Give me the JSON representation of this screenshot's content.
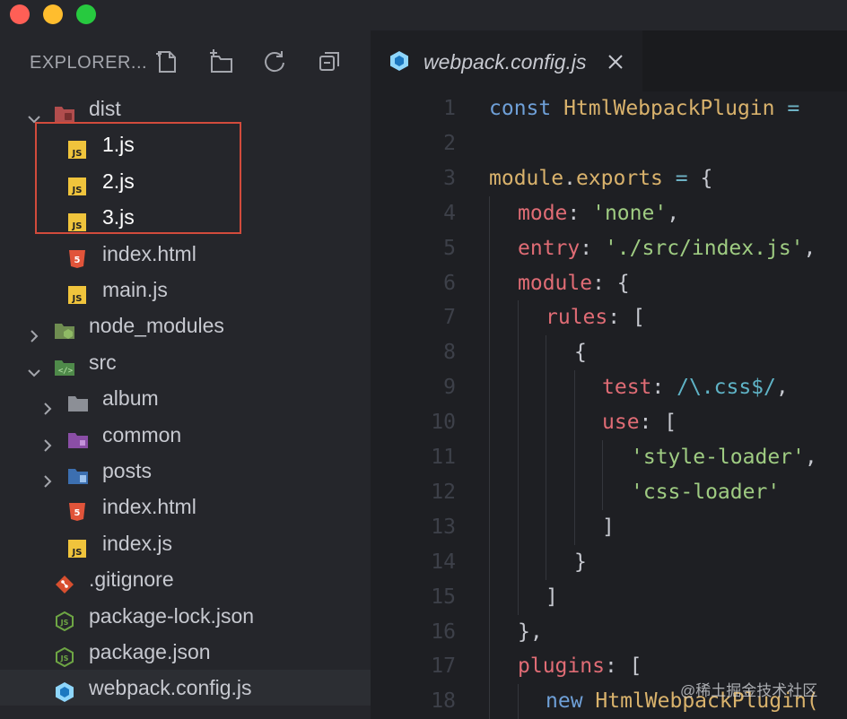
{
  "window": {
    "traffic_lights": [
      {
        "name": "close",
        "color": "#ff5f56"
      },
      {
        "name": "minimize",
        "color": "#ffbd2e"
      },
      {
        "name": "maximize",
        "color": "#27c93f"
      }
    ]
  },
  "explorer": {
    "title": "EXPLORER...",
    "actions": [
      "new-file-icon",
      "new-folder-icon",
      "refresh-icon",
      "collapse-all-icon"
    ],
    "items": [
      {
        "label": "dist",
        "type": "folder",
        "state": "expanded",
        "depth": 0,
        "icon": "folder-dist-icon"
      },
      {
        "label": "1.js",
        "type": "file",
        "depth": 1,
        "icon": "js-file-icon"
      },
      {
        "label": "2.js",
        "type": "file",
        "depth": 1,
        "icon": "js-file-icon"
      },
      {
        "label": "3.js",
        "type": "file",
        "depth": 1,
        "icon": "js-file-icon"
      },
      {
        "label": "index.html",
        "type": "file",
        "depth": 1,
        "icon": "html-file-icon"
      },
      {
        "label": "main.js",
        "type": "file",
        "depth": 1,
        "icon": "js-file-icon"
      },
      {
        "label": "node_modules",
        "type": "folder",
        "state": "collapsed",
        "depth": 0,
        "icon": "folder-node-icon"
      },
      {
        "label": "src",
        "type": "folder",
        "state": "expanded",
        "depth": 0,
        "icon": "folder-src-icon"
      },
      {
        "label": "album",
        "type": "folder",
        "state": "collapsed",
        "depth": 1,
        "icon": "folder-icon"
      },
      {
        "label": "common",
        "type": "folder",
        "state": "collapsed",
        "depth": 1,
        "icon": "folder-common-icon"
      },
      {
        "label": "posts",
        "type": "folder",
        "state": "collapsed",
        "depth": 1,
        "icon": "folder-posts-icon"
      },
      {
        "label": "index.html",
        "type": "file",
        "depth": 1,
        "icon": "html-file-icon"
      },
      {
        "label": "index.js",
        "type": "file",
        "depth": 1,
        "icon": "js-file-icon"
      },
      {
        "label": ".gitignore",
        "type": "file",
        "depth": 0,
        "icon": "git-icon"
      },
      {
        "label": "package-lock.json",
        "type": "file",
        "depth": 0,
        "icon": "nodejs-icon"
      },
      {
        "label": "package.json",
        "type": "file",
        "depth": 0,
        "icon": "nodejs-icon"
      },
      {
        "label": "webpack.config.js",
        "type": "file",
        "depth": 0,
        "icon": "webpack-icon",
        "selected": true
      }
    ]
  },
  "editor": {
    "tab": {
      "label": "webpack.config.js",
      "icon": "webpack-icon"
    },
    "lines": [
      {
        "n": "1",
        "indent": 0,
        "tokens": [
          [
            "kw",
            "const "
          ],
          [
            "cls",
            "HtmlWebpackPlugin "
          ],
          [
            "op",
            "="
          ]
        ]
      },
      {
        "n": "2",
        "indent": 0,
        "tokens": []
      },
      {
        "n": "3",
        "indent": 0,
        "tokens": [
          [
            "cls",
            "module"
          ],
          [
            "punc",
            "."
          ],
          [
            "cls",
            "exports "
          ],
          [
            "op",
            "="
          ],
          [
            "punc",
            " {"
          ]
        ]
      },
      {
        "n": "4",
        "indent": 1,
        "tokens": [
          [
            "prop",
            "mode"
          ],
          [
            "punc",
            ": "
          ],
          [
            "str",
            "'none'"
          ],
          [
            "punc",
            ","
          ]
        ]
      },
      {
        "n": "5",
        "indent": 1,
        "tokens": [
          [
            "prop",
            "entry"
          ],
          [
            "punc",
            ": "
          ],
          [
            "str",
            "'./src/index.js'"
          ],
          [
            "punc",
            ","
          ]
        ]
      },
      {
        "n": "6",
        "indent": 1,
        "tokens": [
          [
            "prop",
            "module"
          ],
          [
            "punc",
            ": {"
          ]
        ]
      },
      {
        "n": "7",
        "indent": 2,
        "tokens": [
          [
            "prop",
            "rules"
          ],
          [
            "punc",
            ": ["
          ]
        ]
      },
      {
        "n": "8",
        "indent": 3,
        "tokens": [
          [
            "punc",
            "{"
          ]
        ]
      },
      {
        "n": "9",
        "indent": 4,
        "tokens": [
          [
            "prop",
            "test"
          ],
          [
            "punc",
            ": "
          ],
          [
            "rx",
            "/\\.css$/"
          ],
          [
            "punc",
            ","
          ]
        ]
      },
      {
        "n": "10",
        "indent": 4,
        "tokens": [
          [
            "prop",
            "use"
          ],
          [
            "punc",
            ": ["
          ]
        ]
      },
      {
        "n": "11",
        "indent": 5,
        "tokens": [
          [
            "str",
            "'style-loader'"
          ],
          [
            "punc",
            ","
          ]
        ]
      },
      {
        "n": "12",
        "indent": 5,
        "tokens": [
          [
            "str",
            "'css-loader'"
          ]
        ]
      },
      {
        "n": "13",
        "indent": 4,
        "tokens": [
          [
            "punc",
            "]"
          ]
        ]
      },
      {
        "n": "14",
        "indent": 3,
        "tokens": [
          [
            "punc",
            "}"
          ]
        ]
      },
      {
        "n": "15",
        "indent": 2,
        "tokens": [
          [
            "punc",
            "]"
          ]
        ]
      },
      {
        "n": "16",
        "indent": 1,
        "tokens": [
          [
            "punc",
            "},"
          ]
        ]
      },
      {
        "n": "17",
        "indent": 1,
        "tokens": [
          [
            "prop",
            "plugins"
          ],
          [
            "punc",
            ": ["
          ]
        ]
      },
      {
        "n": "18",
        "indent": 2,
        "tokens": [
          [
            "kw",
            "new "
          ],
          [
            "cls",
            "HtmlWebpackPlugin("
          ]
        ]
      }
    ]
  },
  "watermark": "@稀土掘金技术社区",
  "colors": {
    "highlight_box": "#d24b3c",
    "js_icon": "#f0c43c",
    "html_icon": "#e1543a"
  }
}
